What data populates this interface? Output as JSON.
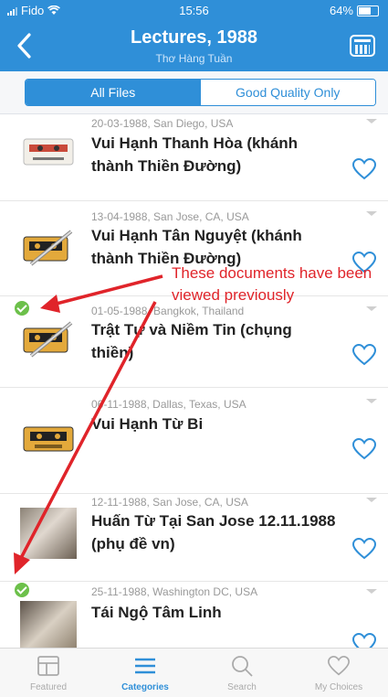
{
  "status_bar": {
    "carrier": "Fido",
    "time": "15:56",
    "battery": "64%"
  },
  "nav": {
    "title": "Lectures, 1988",
    "subtitle": "Thơ Hàng Tuần",
    "back_icon": "chevron-left-icon",
    "calendar_icon": "calendar-icon"
  },
  "segments": {
    "all": "All Files",
    "good": "Good Quality Only",
    "selected": "All Files"
  },
  "list": {
    "items": [
      {
        "meta": "20-03-1988, San Diego, USA",
        "title": "Vui Hạnh Thanh Hòa (khánh thành Thiền Đường)",
        "viewed": false,
        "favorite": false
      },
      {
        "meta": "13-04-1988, San Jose, CA, USA",
        "title": "Vui Hạnh Tân Nguyệt (khánh thành Thiền Đường)",
        "viewed": false,
        "favorite": false
      },
      {
        "meta": "01-05-1988, Bangkok, Thailand",
        "title": "Trật Tự và Niềm Tin (chụng thiền)",
        "viewed": true,
        "favorite": false
      },
      {
        "meta": "06-11-1988, Dallas, Texas, USA",
        "title": "Vui Hạnh Từ Bi",
        "viewed": false,
        "favorite": false
      },
      {
        "meta": "12-11-1988, San Jose, CA, USA",
        "title": "Huấn Từ Tại San Jose 12.11.1988 (phụ đề vn)",
        "viewed": false,
        "favorite": false
      },
      {
        "meta": "25-11-1988, Washington DC, USA",
        "title": "Tái Ngộ Tâm Linh",
        "viewed": true,
        "favorite": false
      }
    ]
  },
  "annotation": {
    "text": "These documents have been viewed previously",
    "color": "#e0242a"
  },
  "tabbar": {
    "tabs": [
      {
        "label": "Featured",
        "icon": "featured-icon"
      },
      {
        "label": "Categories",
        "icon": "list-icon",
        "active": true
      },
      {
        "label": "Search",
        "icon": "search-icon"
      },
      {
        "label": "My Choices",
        "icon": "heart-icon"
      }
    ]
  },
  "colors": {
    "brand": "#2f8fd8",
    "check": "#6cc04a"
  }
}
